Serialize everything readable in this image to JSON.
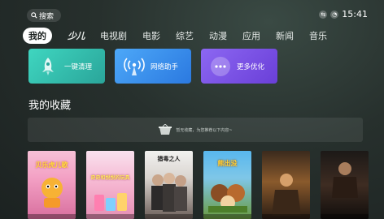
{
  "search": {
    "label": "搜索"
  },
  "status": {
    "time": "15:41"
  },
  "nav": {
    "tabs": [
      "我的",
      "少儿",
      "电视剧",
      "电影",
      "综艺",
      "动漫",
      "应用",
      "新闻",
      "音乐"
    ]
  },
  "quick_actions": [
    {
      "label": "一键清理",
      "icon": "rocket-icon"
    },
    {
      "label": "网络助手",
      "icon": "wifi-broadcast-icon"
    },
    {
      "label": "更多优化",
      "icon": "more-dots-icon"
    }
  ],
  "favorites": {
    "title": "我的收藏",
    "empty_text": "暂无收藏，为您推荐以下内容~"
  },
  "posters": [
    {
      "title": "贝乐虎儿歌"
    },
    {
      "title": "奇奇和悦悦的玩具"
    },
    {
      "title": "猎毒之人"
    },
    {
      "title": "熊出没"
    },
    {
      "title": ""
    },
    {
      "title": ""
    }
  ],
  "colors": {
    "accent_teal": "#2aa59a",
    "accent_blue": "#2b79e0",
    "accent_purple": "#6a3fd8"
  }
}
